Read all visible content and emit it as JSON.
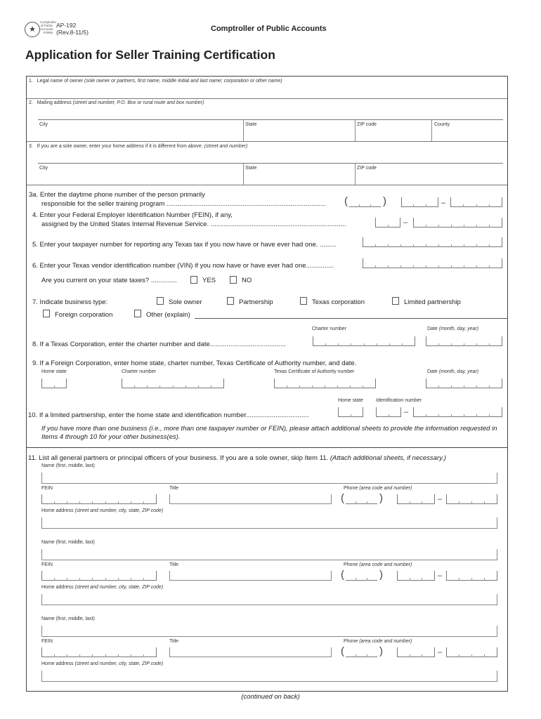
{
  "header": {
    "seal_glyph": "★",
    "seal_text": "Comptroller of Public Accounts FORM",
    "form_number": "AP-192",
    "revision": "(Rev.8-11/5)",
    "agency": "Comptroller of Public Accounts",
    "title": "Application for Seller Training Certification"
  },
  "items": {
    "q1": {
      "num": "1.",
      "label": "Legal name of owner",
      "hint": "(sole owner or partners, first name, middle initial and last name; corporation or other name)"
    },
    "q2": {
      "num": "2.",
      "label": "Mailing address",
      "hint": "(street and number, P.O. Box or rural route and box number)",
      "city": "City",
      "state": "State",
      "zip": "ZIP code",
      "county": "County"
    },
    "q3": {
      "num": "3.",
      "label": "If you are a sole owner, enter your home address if it is different from above.",
      "hint": "(street and number)",
      "city": "City",
      "state": "State",
      "zip": "ZIP code"
    },
    "q3a": {
      "line1": "3a. Enter the daytime phone number of the person primarily",
      "line2": "responsible for the seller training program ......................................................................................"
    },
    "q4": {
      "line1": "4. Enter your Federal Employer Identification Number (FEIN), if any,",
      "line2": "assigned by the United States Internal Revenue Service. ........................................................................."
    },
    "q5": {
      "text": "5. Enter your taxpayer number for reporting any Texas tax if you now have or have ever had one. ........."
    },
    "q6": {
      "text": "6. Enter your Texas vendor identification number (VIN) if you now have or have ever had one...............",
      "taxes_question": "Are you current on your state taxes? ..............",
      "yes": "YES",
      "no": "NO"
    },
    "q7": {
      "text": "7. Indicate business type:",
      "options": [
        "Sole owner",
        "Partnership",
        "Texas corporation",
        "Limited partnership",
        "Foreign corporation",
        "Other (explain)"
      ]
    },
    "q8": {
      "text": "8. If a Texas Corporation, enter the charter number and date.........................................",
      "charter": "Charter number",
      "date": "Date",
      "date_hint": "(month, day, year)"
    },
    "q9": {
      "text": "9. If a Foreign Corporation, enter home state, charter number, Texas Certificate of Authority number, and date.",
      "home_state": "Home state",
      "charter": "Charter number",
      "authority": "Texas Certificate of Authority number",
      "date": "Date",
      "date_hint": "(month, day, year)"
    },
    "q10": {
      "text": "10. If a limited partnership, enter the home state and identification number..................................",
      "home_state": "Home state",
      "id": "Identification number"
    },
    "note": "If you have more than one business (i.e., more than one taxpayer number or FEIN), please attach additional sheets to provide the information requested in Items 4 through 10 for your other business(es).",
    "q11": {
      "text": "11. List all general partners or principal officers of your business. If you are a sole owner, skip Item 11.",
      "hint": "(Attach additional sheets, if necessary.)"
    }
  },
  "officer_labels": {
    "name": "Name (first, middle, last)",
    "fein": "FEIN",
    "title": "Title",
    "phone": "Phone",
    "phone_hint": "(area code and number)",
    "address": "Home address",
    "address_hint": "(street and number, city, state, ZIP code)"
  },
  "footer": "(continued on back)"
}
